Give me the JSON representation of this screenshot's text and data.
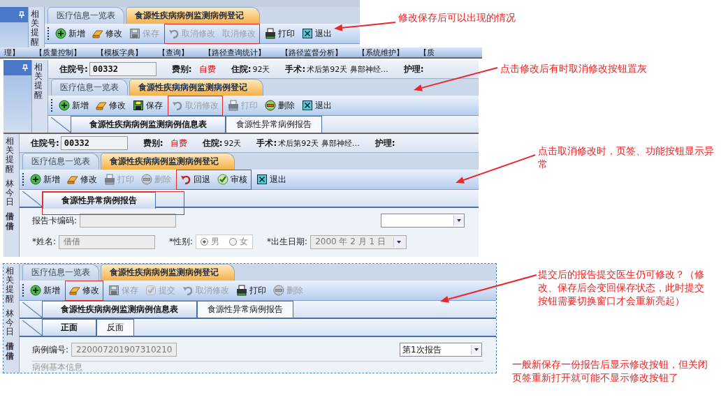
{
  "panels": [
    {
      "sidebar": {
        "pin": true,
        "labels": [
          "相关提醒"
        ]
      },
      "tabs": [
        {
          "label": "医疗信息一览表",
          "selected": false
        },
        {
          "label": "食源性疾病病例监测病例登记",
          "selected": true
        }
      ],
      "toolbar": [
        {
          "label": "新增",
          "kind": "add",
          "disabled": false,
          "highlighted": false
        },
        {
          "label": "修改",
          "kind": "edit",
          "disabled": false,
          "highlighted": false
        },
        {
          "label": "保存",
          "kind": "save",
          "disabled": true,
          "highlighted": false
        },
        {
          "label": "取消修改",
          "kind": "undo",
          "disabled": true,
          "highlighted": true
        },
        {
          "label": "取消修改",
          "kind": "text",
          "disabled": true,
          "highlighted": true
        },
        {
          "label": "打印",
          "kind": "print",
          "disabled": false,
          "highlighted": false
        },
        {
          "label": "退出",
          "kind": "exit",
          "disabled": false,
          "highlighted": false
        }
      ]
    },
    {
      "sidebar": {
        "pin": true,
        "labels": [
          "相关提醒"
        ]
      },
      "info": [
        {
          "label": "住院号:",
          "value": "00332",
          "kind": "box"
        },
        {
          "label": "费别:",
          "value": "自费",
          "kind": "alert"
        },
        {
          "label": "住院:",
          "value": "92天",
          "kind": "plain"
        },
        {
          "label": "手术:",
          "value": "术后第92天  鼻部神经…",
          "kind": "plain"
        },
        {
          "label": "护理:"
        }
      ],
      "tabs": [
        {
          "label": "医疗信息一览表",
          "selected": false
        },
        {
          "label": "食源性疾病病例监测病例登记",
          "selected": true
        }
      ],
      "toolbar": [
        {
          "label": "新增",
          "kind": "add",
          "disabled": false,
          "highlighted": false
        },
        {
          "label": "修改",
          "kind": "edit",
          "disabled": false,
          "highlighted": false
        },
        {
          "label": "保存",
          "kind": "save",
          "disabled": false,
          "highlighted": false
        },
        {
          "label": "取消修改",
          "kind": "undo",
          "disabled": true,
          "highlighted": true
        },
        {
          "label": "打印",
          "kind": "print",
          "disabled": true,
          "highlighted": false
        },
        {
          "label": "删除",
          "kind": "delete",
          "disabled": false,
          "highlighted": false
        },
        {
          "label": "退出",
          "kind": "exit",
          "disabled": false,
          "highlighted": false
        }
      ],
      "subtabs": [
        {
          "label": "食源性疾病病例监测病例信息表",
          "selected": true,
          "highlighted": false
        },
        {
          "label": "食源性异常病例报告",
          "selected": false,
          "highlighted": false
        }
      ]
    },
    {
      "sidebar": {
        "pin": false,
        "labels": [
          "相关提醒",
          "林今日",
          "借借"
        ]
      },
      "info": [
        {
          "label": "住院号:",
          "value": "00332",
          "kind": "box"
        },
        {
          "label": "费别:",
          "value": "自费",
          "kind": "alert"
        },
        {
          "label": "住院:",
          "value": "92天",
          "kind": "plain"
        },
        {
          "label": "手术:",
          "value": "术后第92天  鼻部神经…",
          "kind": "plain"
        },
        {
          "label": "护理:"
        }
      ],
      "tabs": [
        {
          "label": "医疗信息一览表",
          "selected": false
        },
        {
          "label": "食源性疾病病例监测病例登记",
          "selected": true
        }
      ],
      "toolbar": [
        {
          "label": "新增",
          "kind": "add",
          "disabled": false,
          "highlighted": false
        },
        {
          "label": "修改",
          "kind": "edit",
          "disabled": false,
          "highlighted": false
        },
        {
          "label": "打印",
          "kind": "print",
          "disabled": true,
          "highlighted": false
        },
        {
          "label": "删除",
          "kind": "delete",
          "disabled": true,
          "highlighted": false
        },
        {
          "label": "回退",
          "kind": "back",
          "disabled": false,
          "highlighted": true
        },
        {
          "label": "审核",
          "kind": "approve",
          "disabled": false,
          "highlighted": true
        },
        {
          "label": "退出",
          "kind": "exit",
          "disabled": false,
          "highlighted": false
        }
      ],
      "subtabs": [
        {
          "label": "食源性异常病例报告",
          "selected": true,
          "highlighted": true
        }
      ],
      "form": [
        [
          {
            "kind": "text",
            "label": "报告卡编码:",
            "disabled": true
          },
          {
            "kind": "select"
          }
        ],
        [
          {
            "kind": "text",
            "label": "*姓名:",
            "value": "借借",
            "disabled": true
          },
          {
            "kind": "radio",
            "label": "*性别:",
            "options": [
              {
                "label": "男",
                "selected": true
              },
              {
                "label": "女",
                "selected": false
              }
            ]
          },
          {
            "kind": "date",
            "label": "*出生日期:",
            "value": "2000 年 2 月 1 日",
            "disabled": true
          }
        ]
      ]
    },
    {
      "sidebar": {
        "pin": false,
        "labels": [
          "相关提醒",
          "林今日",
          "借借"
        ]
      },
      "tabs": [
        {
          "label": "医疗信息一览表",
          "selected": false
        },
        {
          "label": "食源性疾病病例监测病例登记",
          "selected": true
        }
      ],
      "toolbar": [
        {
          "label": "新增",
          "kind": "add",
          "disabled": false,
          "highlighted": false
        },
        {
          "label": "修改",
          "kind": "edit",
          "disabled": false,
          "highlighted": true
        },
        {
          "label": "保存",
          "kind": "save",
          "disabled": true,
          "highlighted": false
        },
        {
          "label": "提交",
          "kind": "submit",
          "disabled": true,
          "highlighted": false
        },
        {
          "label": "取消修改",
          "kind": "undo",
          "disabled": true,
          "highlighted": false
        },
        {
          "label": "打印",
          "kind": "print",
          "disabled": false,
          "highlighted": false
        },
        {
          "label": "删除",
          "kind": "delete",
          "disabled": true,
          "highlighted": false
        }
      ],
      "subtabs": [
        {
          "label": "食源性疾病病例监测病例信息表",
          "selected": true,
          "highlighted": false
        },
        {
          "label": "食源性异常病例报告",
          "selected": false,
          "highlighted": false
        }
      ],
      "pagetabs": [
        {
          "label": "正面",
          "selected": true
        },
        {
          "label": "反面",
          "selected": false
        }
      ],
      "form": [
        [
          {
            "kind": "text",
            "label": "病例编号:",
            "value": "220007201907310210",
            "disabled": true
          },
          {
            "kind": "select",
            "value": "第1次报告"
          }
        ],
        [
          {
            "kind": "legend",
            "label": "病例基本信息"
          }
        ]
      ]
    }
  ],
  "menu": [
    "理】",
    "【质量控制】",
    "【模板字典】",
    "【查询】",
    "【路径查询统计】",
    "【路径监督分析】",
    "【系统维护】",
    "【质"
  ],
  "annotations": [
    {
      "text": "修改保存后可以出现的情况"
    },
    {
      "text": "点击修改后有时取消修改按钮置灰"
    },
    {
      "text": "点击取消修改时，页签、功能按钮显示异常"
    },
    {
      "text": "提交后的报告提交医生仍可修改？（修改、保存后会变回保存状态，此时提交按钮需要切换窗口才会重新亮起）"
    },
    {
      "text": "一般新保存一份报告后显示修改按钮，但关闭页签重新打开就可能不显示修改按钮了"
    }
  ]
}
